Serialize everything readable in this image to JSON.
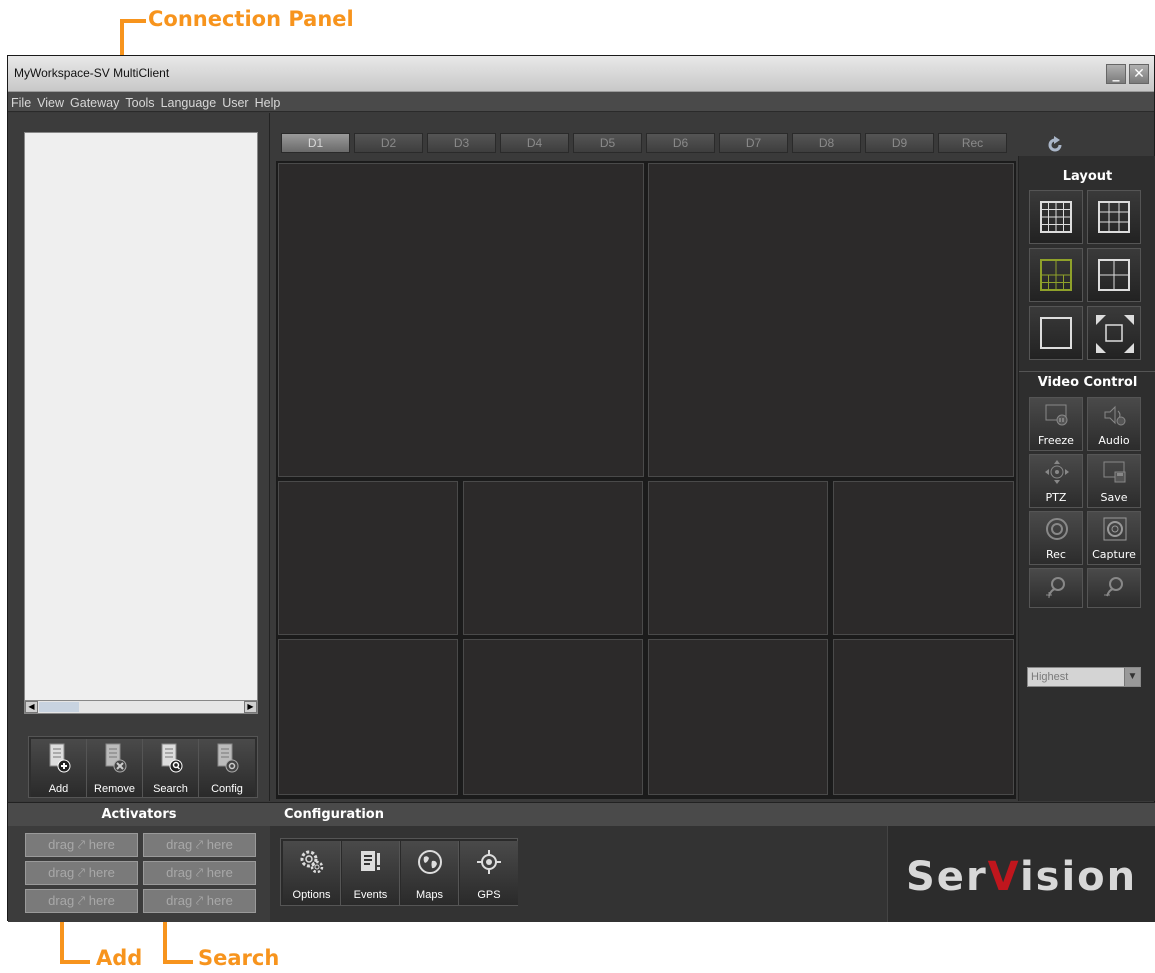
{
  "annotations": {
    "connection_panel": "Connection Panel",
    "add": "Add",
    "search": "Search"
  },
  "window": {
    "title": "MyWorkspace-SV MultiClient",
    "minimize": "_",
    "close": "✕"
  },
  "menu": [
    "File",
    "View",
    "Gateway",
    "Tools",
    "Language",
    "User",
    "Help"
  ],
  "connection_panel": {
    "scroll_left": "◀",
    "scroll_right": "▶",
    "tools": [
      {
        "label": "Add",
        "icon": "server-add-icon"
      },
      {
        "label": "Remove",
        "icon": "server-remove-icon"
      },
      {
        "label": "Search",
        "icon": "server-search-icon"
      },
      {
        "label": "Config",
        "icon": "server-config-icon"
      }
    ]
  },
  "tabs": [
    "D1",
    "D2",
    "D3",
    "D4",
    "D5",
    "D6",
    "D7",
    "D8",
    "D9",
    "Rec"
  ],
  "active_tab": "D1",
  "layout_panel": {
    "title": "Layout",
    "buttons": [
      "grid-4x4-icon",
      "grid-3x3-icon",
      "grid-2-plus-8-icon",
      "grid-2x2-icon",
      "grid-1x1-icon",
      "fullscreen-icon"
    ],
    "selected": "grid-2-plus-8-icon"
  },
  "video_control": {
    "title": "Video Control",
    "buttons": [
      {
        "label": "Freeze",
        "icon": "freeze-icon"
      },
      {
        "label": "Audio",
        "icon": "audio-icon"
      },
      {
        "label": "PTZ",
        "icon": "ptz-icon"
      },
      {
        "label": "Save",
        "icon": "save-icon"
      },
      {
        "label": "Rec",
        "icon": "record-icon"
      },
      {
        "label": "Capture",
        "icon": "capture-icon"
      },
      {
        "label": "",
        "icon": "user-add-icon"
      },
      {
        "label": "",
        "icon": "user-remove-icon"
      }
    ],
    "quality": "Highest"
  },
  "activators": {
    "title": "Activators",
    "slots": [
      {
        "left": "drag",
        "right": "here"
      },
      {
        "left": "drag",
        "right": "here"
      },
      {
        "left": "drag",
        "right": "here"
      },
      {
        "left": "drag",
        "right": "here"
      },
      {
        "left": "drag",
        "right": "here"
      },
      {
        "left": "drag",
        "right": "here"
      }
    ]
  },
  "configuration": {
    "title": "Configuration",
    "buttons": [
      {
        "label": "Options",
        "icon": "options-gear-icon"
      },
      {
        "label": "Events",
        "icon": "events-icon"
      },
      {
        "label": "Maps",
        "icon": "globe-icon"
      },
      {
        "label": "GPS",
        "icon": "gps-icon"
      }
    ]
  },
  "brand": {
    "left": "Ser",
    "v": "V",
    "right": "ision",
    "v_color": "#c0161d"
  },
  "colors": {
    "annotation": "#f7941d",
    "layout_selected": "#8fa12a"
  }
}
